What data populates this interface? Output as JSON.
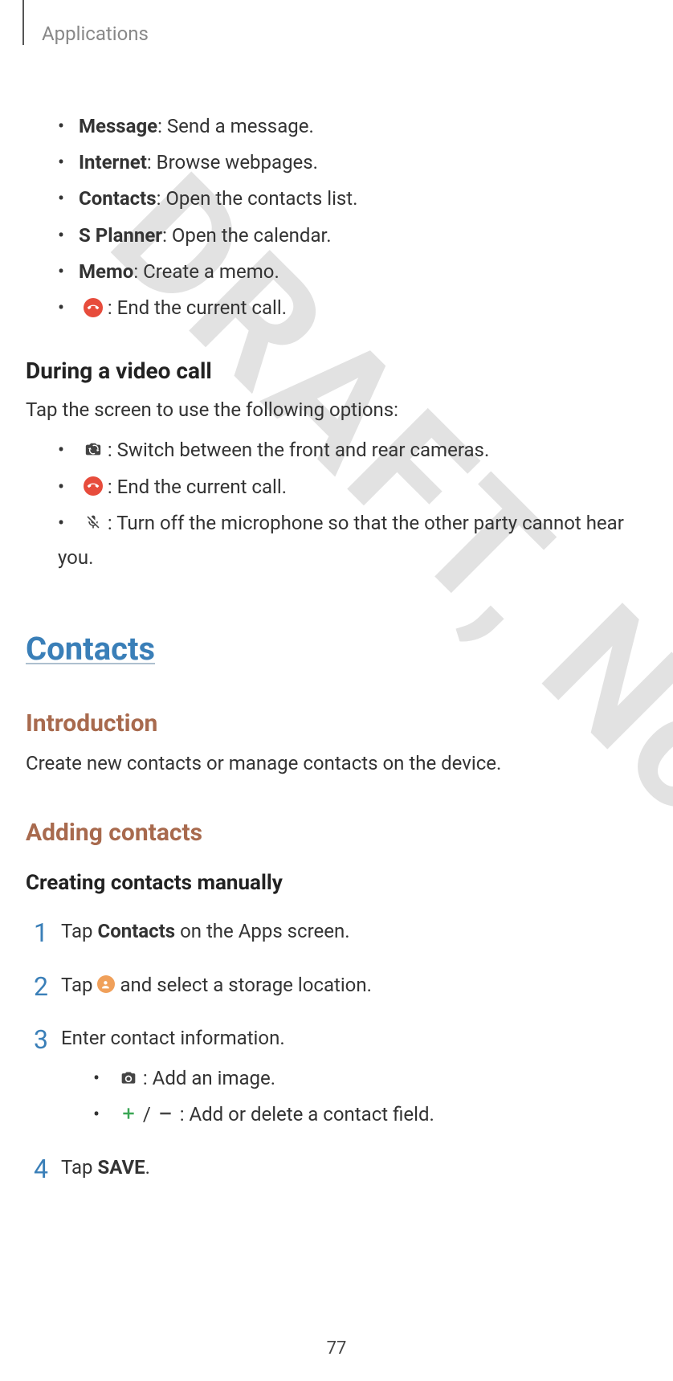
{
  "header": {
    "title": "Applications"
  },
  "watermark": "DRAFT, Not FINAL",
  "bullets1": [
    {
      "bold": "Message",
      "rest": ": Send a message."
    },
    {
      "bold": "Internet",
      "rest": ": Browse webpages."
    },
    {
      "bold": "Contacts",
      "rest": ": Open the contacts list."
    },
    {
      "bold": "S Planner",
      "rest": ": Open the calendar."
    },
    {
      "bold": "Memo",
      "rest": ": Create a memo."
    }
  ],
  "endCall": " : End the current call.",
  "videoCall": {
    "heading": "During a video call",
    "intro": "Tap the screen to use the following options:",
    "switchCam": " : Switch between the front and rear cameras.",
    "endCall": " : End the current call.",
    "micOff": " : Turn off the microphone so that the other party cannot hear you."
  },
  "contacts": {
    "title": "Contacts",
    "intro": {
      "heading": "Introduction",
      "body": "Create new contacts or manage contacts on the device."
    },
    "adding": {
      "heading": "Adding contacts",
      "manual": {
        "heading": "Creating contacts manually",
        "step1_a": "Tap ",
        "step1_b": "Contacts",
        "step1_c": " on the Apps screen.",
        "step2_a": "Tap ",
        "step2_b": " and select a storage location.",
        "step3": "Enter contact information.",
        "step3_img": " : Add an image.",
        "step3_field_a": " / ",
        "step3_field_b": " : Add or delete a contact field.",
        "step4_a": "Tap ",
        "step4_b": "SAVE",
        "step4_c": "."
      }
    }
  },
  "pageNumber": "77"
}
